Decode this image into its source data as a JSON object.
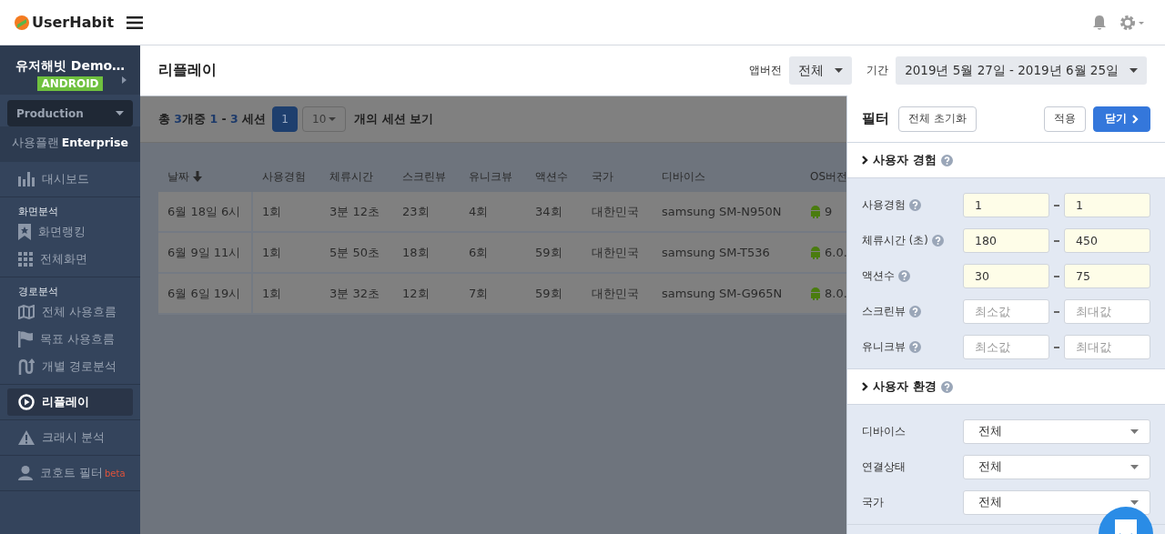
{
  "topbar": {
    "brand": "UserHabit"
  },
  "sidebar": {
    "project": "유저해빗 Demo…",
    "platform": "ANDROID",
    "environment": "Production",
    "plan_label": "사용플랜",
    "plan": "Enterprise",
    "groups": [
      {
        "items": [
          {
            "label": "대시보드",
            "selected": false
          }
        ]
      },
      {
        "header": "화면분석",
        "items": [
          {
            "label": "화면랭킹",
            "selected": false
          },
          {
            "label": "전체화면",
            "selected": false
          }
        ]
      },
      {
        "header": "경로분석",
        "items": [
          {
            "label": "전체 사용흐름",
            "selected": false
          },
          {
            "label": "목표 사용흐름",
            "selected": false
          },
          {
            "label": "개별 경로분석",
            "selected": false
          }
        ]
      },
      {
        "items": [
          {
            "label": "리플레이",
            "selected": true
          }
        ]
      },
      {
        "items": [
          {
            "label": "크래시 분석",
            "selected": false
          }
        ]
      },
      {
        "items": [
          {
            "label": "코호트 필터",
            "selected": false,
            "badge": "beta"
          }
        ]
      }
    ]
  },
  "header": {
    "title": "리플레이",
    "version_label": "앱버전",
    "version": "전체",
    "period_label": "기간",
    "period": "2019년 5월 27일 - 2019년 6월 25일"
  },
  "toolbar": {
    "summary": [
      {
        "text": "총 ",
        "highlight": false
      },
      {
        "text": "3",
        "highlight": true
      },
      {
        "text": "개중 ",
        "highlight": false
      },
      {
        "text": "1",
        "highlight": true
      },
      {
        "text": " - ",
        "highlight": false
      },
      {
        "text": "3",
        "highlight": true
      },
      {
        "text": " 세션",
        "highlight": false
      }
    ],
    "pages": [
      {
        "label": "1",
        "selected": true
      }
    ],
    "page_size": "10",
    "page_size_label": "개의 세션 보기"
  },
  "table": {
    "columns": [
      "날짜",
      "사용경험",
      "체류시간",
      "스크린뷰",
      "유니크뷰",
      "액션수",
      "국가",
      "디바이스",
      "OS버전"
    ],
    "rows": [
      [
        "6월 18일 6시",
        "1회",
        "3분 12초",
        "23회",
        "4회",
        "34회",
        "대한민국",
        "samsung SM-N950N",
        "9"
      ],
      [
        "6월 9일 11시",
        "1회",
        "5분 50초",
        "18회",
        "6회",
        "59회",
        "대한민국",
        "samsung SM-T536",
        "6.0."
      ],
      [
        "6월 6일 19시",
        "1회",
        "3분 32초",
        "12회",
        "7회",
        "59회",
        "대한민국",
        "samsung SM-G965N",
        "8.0."
      ]
    ]
  },
  "filter": {
    "title": "필터",
    "reset": "전체 초기화",
    "apply": "적용",
    "close": "닫기",
    "sections": [
      {
        "title": "사용자 경험",
        "rows": [
          {
            "kind": "range",
            "label": "사용경험",
            "min": {
              "value": "1"
            },
            "max": {
              "value": "1"
            }
          },
          {
            "kind": "range",
            "label": "체류시간 (초)",
            "min": {
              "value": "180"
            },
            "max": {
              "value": "450"
            }
          },
          {
            "kind": "range",
            "label": "액션수",
            "min": {
              "value": "30"
            },
            "max": {
              "value": "75"
            }
          },
          {
            "kind": "range",
            "label": "스크린뷰",
            "min": {
              "placeholder": "최소값"
            },
            "max": {
              "placeholder": "최대값"
            }
          },
          {
            "kind": "range",
            "label": "유니크뷰",
            "min": {
              "placeholder": "최소값"
            },
            "max": {
              "placeholder": "최대값"
            }
          }
        ]
      },
      {
        "title": "사용자 환경",
        "rows": [
          {
            "kind": "select",
            "label": "디바이스",
            "value": "전체"
          },
          {
            "kind": "select",
            "label": "연결상태",
            "value": "전체"
          },
          {
            "kind": "select",
            "label": "국가",
            "value": "전체"
          }
        ]
      }
    ]
  }
}
